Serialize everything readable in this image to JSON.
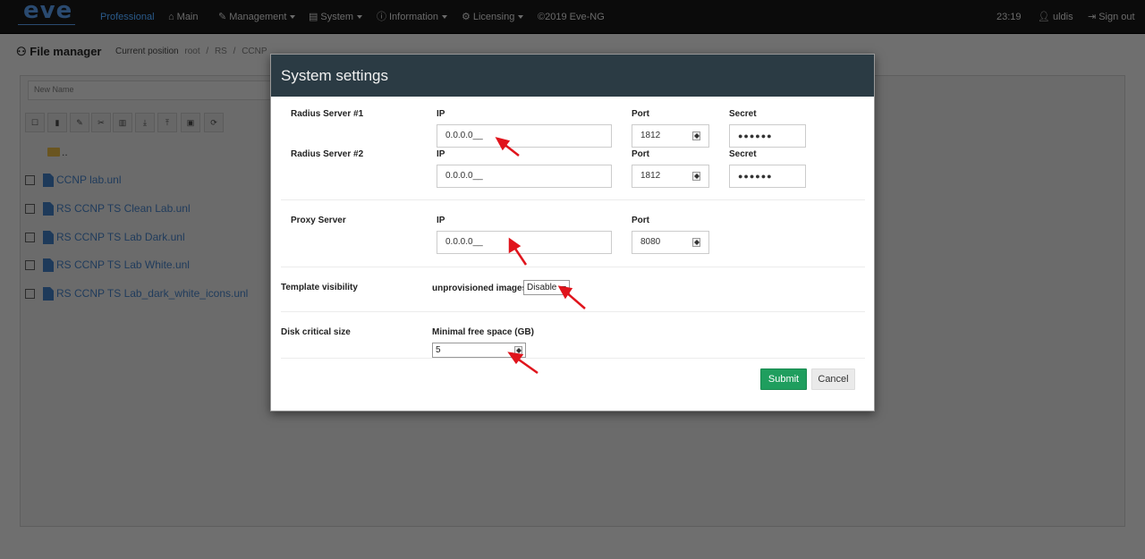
{
  "navbar": {
    "logo_text": "eve",
    "items": [
      {
        "label": "Professional"
      },
      {
        "label": "Main",
        "icon": "home-icon"
      },
      {
        "label": "Management",
        "icon": "wrench-icon"
      },
      {
        "label": "System",
        "icon": "server-icon"
      },
      {
        "label": "Information",
        "icon": "info-icon"
      },
      {
        "label": "Licensing",
        "icon": "gear-icon"
      },
      {
        "label": "©2019 Eve-NG"
      }
    ],
    "time": "23:19",
    "user": "uldis",
    "signout": "Sign out"
  },
  "page": {
    "title": "File manager",
    "breadcrumb": {
      "label": "Current position",
      "items": [
        "root",
        "RS",
        "CCNP"
      ],
      "sep": "/"
    }
  },
  "file_manager": {
    "new_name_placeholder": "New Name",
    "parent_folder": "..",
    "files": [
      "CCNP lab.unl",
      "RS CCNP TS Clean Lab.unl",
      "RS CCNP TS Lab Dark.unl",
      "RS CCNP TS Lab White.unl",
      "RS CCNP TS Lab_dark_white_icons.unl"
    ]
  },
  "modal": {
    "title": "System settings",
    "radius1": {
      "label": "Radius Server #1",
      "ip_label": "IP",
      "ip": "0.0.0.0__",
      "port_label": "Port",
      "port": "1812",
      "secret_label": "Secret",
      "secret": "●●●●●●"
    },
    "radius2": {
      "label": "Radius Server #2",
      "ip_label": "IP",
      "ip": "0.0.0.0__",
      "port_label": "Port",
      "port": "1812",
      "secret_label": "Secret",
      "secret": "●●●●●●"
    },
    "proxy": {
      "label": "Proxy Server",
      "ip_label": "IP",
      "ip": "0.0.0.0__",
      "port_label": "Port",
      "port": "8080"
    },
    "template": {
      "label": "Template visibility",
      "sub_label": "unprovisioned images",
      "value": "Disable"
    },
    "disk": {
      "label": "Disk critical size",
      "sub_label": "Minimal free space (GB)",
      "value": "5"
    },
    "submit": "Submit",
    "cancel": "Cancel"
  },
  "colors": {
    "submit": "#1f9e5e",
    "modal_header": "#2b3b44",
    "arrow": "#e0141c"
  }
}
